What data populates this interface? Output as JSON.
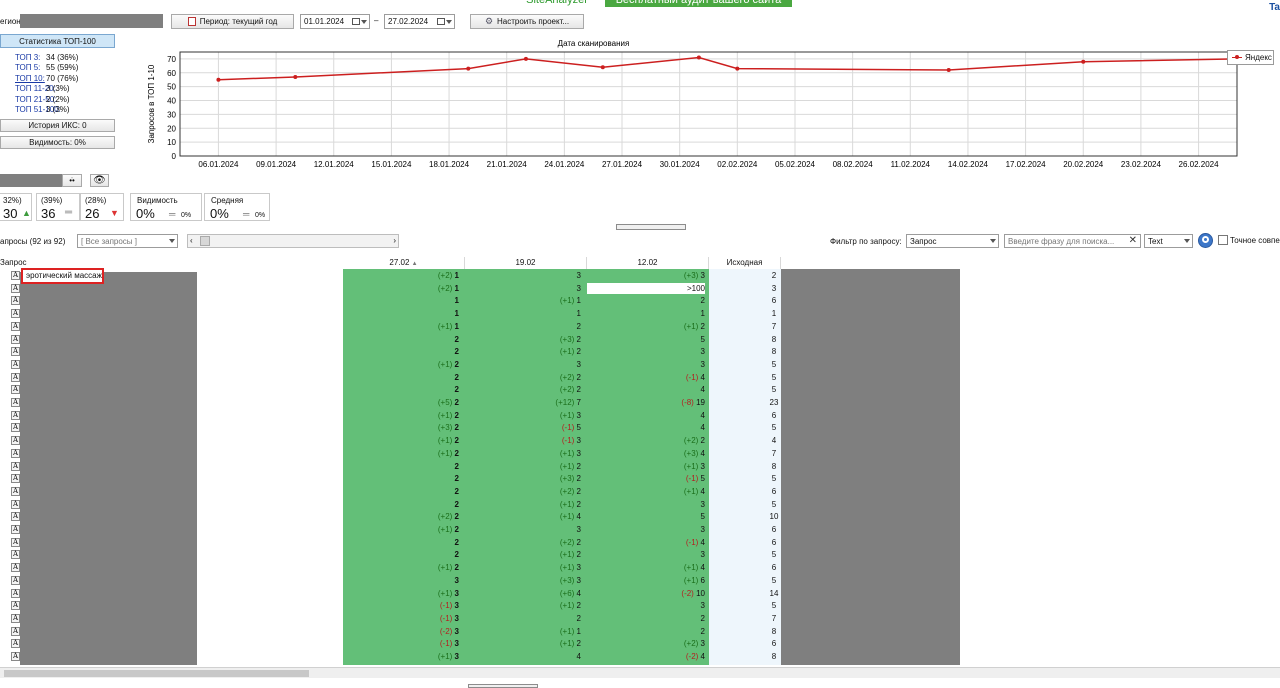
{
  "banner": {
    "title": "SiteAnalyzer",
    "ad": "Бесплатный аудит вашего сайта",
    "right_link": "Ta"
  },
  "toolbar": {
    "region_label": "егион:",
    "period_button": "Период: текущий год",
    "date_from": "01.01.2024",
    "date_sep": "–",
    "date_to": "27.02.2024",
    "configure_button": "Настроить проект..."
  },
  "left_panel": {
    "stats_button": "Статистика ТОП-100",
    "stats": [
      {
        "key": "ТОП 3:",
        "value": "34 (36%)",
        "underline": false
      },
      {
        "key": "ТОП 5:",
        "value": "55 (59%)",
        "underline": false
      },
      {
        "key": "ТОП 10:",
        "value": "70 (76%)",
        "underline": true
      },
      {
        "key": "ТОП 11-20:",
        "value": "3 (3%)",
        "underline": false
      },
      {
        "key": "ТОП 21-50:",
        "value": "2 (2%)",
        "underline": false
      },
      {
        "key": "ТОП 51-100:",
        "value": "3 (3%)",
        "underline": false
      }
    ],
    "iks_button": "История ИКС: 0",
    "visibility_button": "Видимость: 0%"
  },
  "chart_data": {
    "type": "line",
    "title": "Дата сканирования",
    "ylabel": "Запросов в ТОП 1-10",
    "xlabel": "",
    "ylim": [
      0,
      75
    ],
    "yticks": [
      "0",
      "10",
      "20",
      "30",
      "40",
      "50",
      "60",
      "70"
    ],
    "x_ticks": [
      "06.01.2024",
      "09.01.2024",
      "12.01.2024",
      "15.01.2024",
      "18.01.2024",
      "21.01.2024",
      "24.01.2024",
      "27.01.2024",
      "30.01.2024",
      "02.02.2024",
      "05.02.2024",
      "08.02.2024",
      "11.02.2024",
      "14.02.2024",
      "17.02.2024",
      "20.02.2024",
      "23.02.2024",
      "26.02.2024"
    ],
    "grid": true,
    "legend": "top-right",
    "series": [
      {
        "name": "Яндекс",
        "color": "#cc1f1f",
        "points": [
          [
            "2024-01-06",
            55
          ],
          [
            "2024-01-10",
            57
          ],
          [
            "2024-01-19",
            63
          ],
          [
            "2024-01-22",
            70
          ],
          [
            "2024-01-26",
            64
          ],
          [
            "2024-01-31",
            71
          ],
          [
            "2024-02-02",
            63
          ],
          [
            "2024-02-13",
            62
          ],
          [
            "2024-02-20",
            68
          ],
          [
            "2024-02-28",
            70
          ]
        ]
      }
    ]
  },
  "summary": {
    "cards": [
      {
        "pct": "32%)",
        "value": "30",
        "trend": "up"
      },
      {
        "pct": "(39%)",
        "value": "36",
        "trend": "flat"
      },
      {
        "pct": "(28%)",
        "value": "26",
        "trend": "down"
      }
    ],
    "visibility_label": "Видимость",
    "visibility_value": "0%",
    "visibility_sub": "0%",
    "avg_label": "Средняя",
    "avg_value": "0%",
    "avg_sub": "0%"
  },
  "filter_bar": {
    "queries_label": "апросы (92 из 92)",
    "all_queries": "[ Все запросы ]",
    "filter_label": "Фильтр по запросу:",
    "filter_type": "Запрос",
    "search_placeholder": "Введите фразу для поиска...",
    "format": "Text",
    "exact_match": "Точное совпе"
  },
  "grid": {
    "col_query": "Запрос",
    "col_d1": "27.02",
    "col_d2": "19.02",
    "col_d3": "12.02",
    "col_start": "Исходная",
    "selected_query": "эротический массаж",
    "rows": [
      {
        "a": "(+2)",
        "b": "1",
        "c": "",
        "d": "3",
        "e": "(+3)",
        "f": "3",
        "s": "2",
        "w": false
      },
      {
        "a": "(+2)",
        "b": "1",
        "c": "",
        "d": "3",
        "e": "",
        "f": ">100",
        "s": "3",
        "w": true
      },
      {
        "a": "",
        "b": "1",
        "c": "(+1)",
        "d": "1",
        "e": "",
        "f": "2",
        "s": "6",
        "w": false
      },
      {
        "a": "",
        "b": "1",
        "c": "",
        "d": "1",
        "e": "",
        "f": "1",
        "s": "1",
        "w": false
      },
      {
        "a": "(+1)",
        "b": "1",
        "c": "",
        "d": "2",
        "e": "(+1)",
        "f": "2",
        "s": "7",
        "w": false
      },
      {
        "a": "",
        "b": "2",
        "c": "(+3)",
        "d": "2",
        "e": "",
        "f": "5",
        "s": "8",
        "w": false
      },
      {
        "a": "",
        "b": "2",
        "c": "(+1)",
        "d": "2",
        "e": "",
        "f": "3",
        "s": "8",
        "w": false
      },
      {
        "a": "(+1)",
        "b": "2",
        "c": "",
        "d": "3",
        "e": "",
        "f": "3",
        "s": "5",
        "w": false
      },
      {
        "a": "",
        "b": "2",
        "c": "(+2)",
        "d": "2",
        "e": "(-1)",
        "f": "4",
        "s": "5",
        "w": false
      },
      {
        "a": "",
        "b": "2",
        "c": "(+2)",
        "d": "2",
        "e": "",
        "f": "4",
        "s": "5",
        "w": false
      },
      {
        "a": "(+5)",
        "b": "2",
        "c": "(+12)",
        "d": "7",
        "e": "(-8)",
        "f": "19",
        "s": "23",
        "w": false
      },
      {
        "a": "(+1)",
        "b": "2",
        "c": "(+1)",
        "d": "3",
        "e": "",
        "f": "4",
        "s": "6",
        "w": false
      },
      {
        "a": "(+3)",
        "b": "2",
        "c": "(-1)",
        "d": "5",
        "e": "",
        "f": "4",
        "s": "5",
        "w": false
      },
      {
        "a": "(+1)",
        "b": "2",
        "c": "(-1)",
        "d": "3",
        "e": "(+2)",
        "f": "2",
        "s": "4",
        "w": false
      },
      {
        "a": "(+1)",
        "b": "2",
        "c": "(+1)",
        "d": "3",
        "e": "(+3)",
        "f": "4",
        "s": "7",
        "w": false
      },
      {
        "a": "",
        "b": "2",
        "c": "(+1)",
        "d": "2",
        "e": "(+1)",
        "f": "3",
        "s": "8",
        "w": false
      },
      {
        "a": "",
        "b": "2",
        "c": "(+3)",
        "d": "2",
        "e": "(-1)",
        "f": "5",
        "s": "5",
        "w": false
      },
      {
        "a": "",
        "b": "2",
        "c": "(+2)",
        "d": "2",
        "e": "(+1)",
        "f": "4",
        "s": "6",
        "w": false
      },
      {
        "a": "",
        "b": "2",
        "c": "(+1)",
        "d": "2",
        "e": "",
        "f": "3",
        "s": "5",
        "w": false
      },
      {
        "a": "(+2)",
        "b": "2",
        "c": "(+1)",
        "d": "4",
        "e": "",
        "f": "5",
        "s": "10",
        "w": false
      },
      {
        "a": "(+1)",
        "b": "2",
        "c": "",
        "d": "3",
        "e": "",
        "f": "3",
        "s": "6",
        "w": false
      },
      {
        "a": "",
        "b": "2",
        "c": "(+2)",
        "d": "2",
        "e": "(-1)",
        "f": "4",
        "s": "6",
        "w": false
      },
      {
        "a": "",
        "b": "2",
        "c": "(+1)",
        "d": "2",
        "e": "",
        "f": "3",
        "s": "5",
        "w": false
      },
      {
        "a": "(+1)",
        "b": "2",
        "c": "(+1)",
        "d": "3",
        "e": "(+1)",
        "f": "4",
        "s": "6",
        "w": false
      },
      {
        "a": "",
        "b": "3",
        "c": "(+3)",
        "d": "3",
        "e": "(+1)",
        "f": "6",
        "s": "5",
        "w": false
      },
      {
        "a": "(+1)",
        "b": "3",
        "c": "(+6)",
        "d": "4",
        "e": "(-2)",
        "f": "10",
        "s": "14",
        "w": false
      },
      {
        "a": "(-1)",
        "b": "3",
        "c": "(+1)",
        "d": "2",
        "e": "",
        "f": "3",
        "s": "5",
        "w": false
      },
      {
        "a": "(-1)",
        "b": "3",
        "c": "",
        "d": "2",
        "e": "",
        "f": "2",
        "s": "7",
        "w": false
      },
      {
        "a": "(-2)",
        "b": "3",
        "c": "(+1)",
        "d": "1",
        "e": "",
        "f": "2",
        "s": "8",
        "w": false
      },
      {
        "a": "(-1)",
        "b": "3",
        "c": "(+1)",
        "d": "2",
        "e": "(+2)",
        "f": "3",
        "s": "6",
        "w": false
      },
      {
        "a": "(+1)",
        "b": "3",
        "c": "",
        "d": "4",
        "e": "(-2)",
        "f": "4",
        "s": "8",
        "w": false
      }
    ]
  },
  "colors": {
    "green_cell": "#63bf78",
    "green_light": "#7ccb8c",
    "start_col": "#eef6fc",
    "gray_block": "#7f7f7f",
    "accent_red": "#cc1f1f"
  }
}
